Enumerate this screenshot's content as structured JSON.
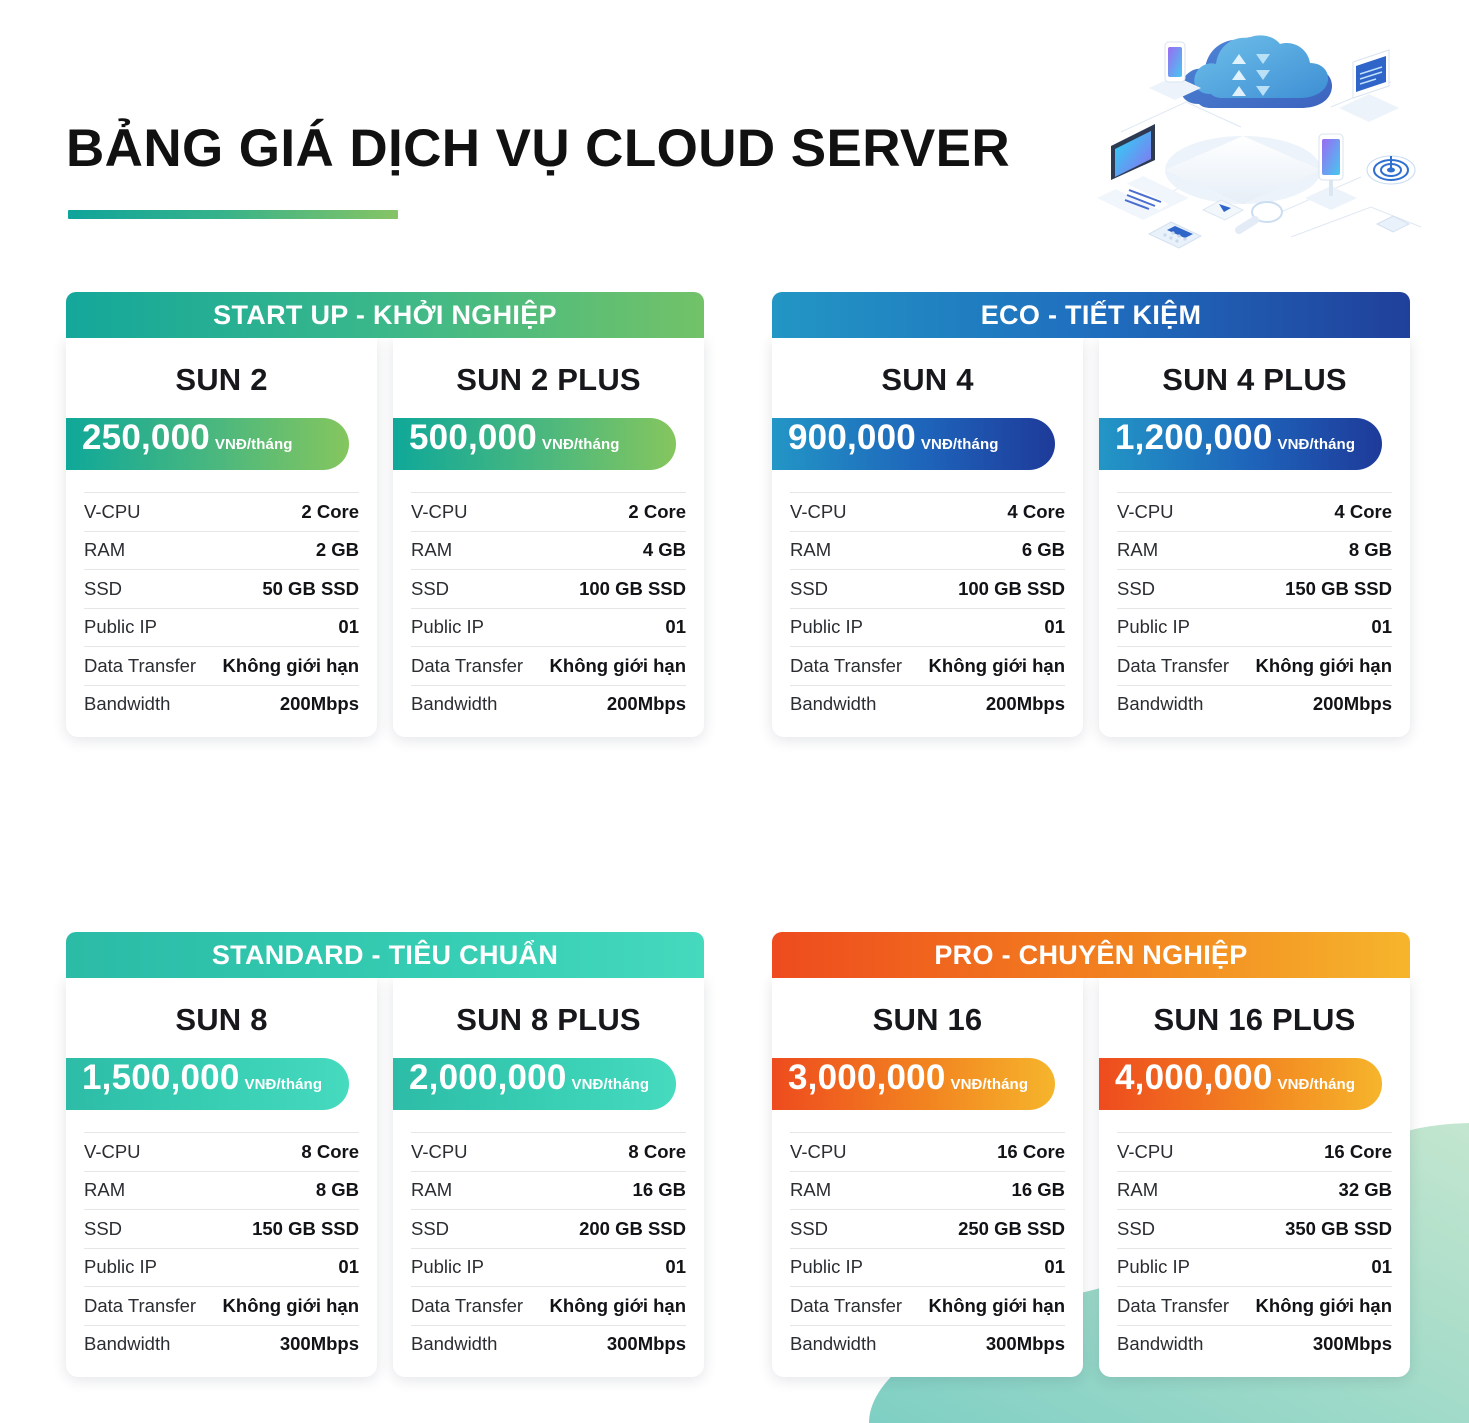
{
  "header": {
    "title": "BẢNG GIÁ DỊCH VỤ CLOUD SERVER",
    "illustration_name": "isometric-cloud-computing-illustration"
  },
  "colors": {
    "startup_from": "#14A79B",
    "startup_to": "#72C268",
    "eco_from": "#2296C4",
    "eco_to": "#20409B",
    "standard_from": "#2BBBA6",
    "standard_to": "#45D9BE",
    "pro_from": "#EE4B1E",
    "pro_to": "#F6B52C",
    "corner_wave": "#A8DCCB"
  },
  "spec_labels": [
    "V-CPU",
    "RAM",
    "SSD",
    "Public IP",
    "Data Transfer",
    "Bandwidth"
  ],
  "groups": [
    {
      "id": "startup",
      "title": "START UP - KHỞI NGHIỆP",
      "plans": [
        {
          "name": "SUN 2",
          "price": "250,000",
          "unit": "VNĐ/tháng",
          "specs": {
            "vcpu": "2 Core",
            "ram": "2 GB",
            "ssd": "50 GB SSD",
            "public_ip": "01",
            "data_transfer": "Không giới hạn",
            "bandwidth": "200Mbps"
          }
        },
        {
          "name": "SUN 2 PLUS",
          "price": "500,000",
          "unit": "VNĐ/tháng",
          "specs": {
            "vcpu": "2 Core",
            "ram": "4 GB",
            "ssd": "100 GB SSD",
            "public_ip": "01",
            "data_transfer": "Không giới hạn",
            "bandwidth": "200Mbps"
          }
        }
      ]
    },
    {
      "id": "eco",
      "title": "ECO - TIẾT KIỆM",
      "plans": [
        {
          "name": "SUN 4",
          "price": "900,000",
          "unit": "VNĐ/tháng",
          "specs": {
            "vcpu": "4 Core",
            "ram": "6 GB",
            "ssd": "100 GB SSD",
            "public_ip": "01",
            "data_transfer": "Không giới hạn",
            "bandwidth": "200Mbps"
          }
        },
        {
          "name": "SUN 4 PLUS",
          "price": "1,200,000",
          "unit": "VNĐ/tháng",
          "specs": {
            "vcpu": "4 Core",
            "ram": "8 GB",
            "ssd": "150 GB SSD",
            "public_ip": "01",
            "data_transfer": "Không giới hạn",
            "bandwidth": "200Mbps"
          }
        }
      ]
    },
    {
      "id": "standard",
      "title": "STANDARD - TIÊU CHUẨN",
      "plans": [
        {
          "name": "SUN 8",
          "price": "1,500,000",
          "unit": "VNĐ/tháng",
          "specs": {
            "vcpu": "8 Core",
            "ram": "8 GB",
            "ssd": "150 GB SSD",
            "public_ip": "01",
            "data_transfer": "Không giới hạn",
            "bandwidth": "300Mbps"
          }
        },
        {
          "name": "SUN 8 PLUS",
          "price": "2,000,000",
          "unit": "VNĐ/tháng",
          "specs": {
            "vcpu": "8 Core",
            "ram": "16 GB",
            "ssd": "200 GB SSD",
            "public_ip": "01",
            "data_transfer": "Không giới hạn",
            "bandwidth": "300Mbps"
          }
        }
      ]
    },
    {
      "id": "pro",
      "title": "PRO - CHUYÊN NGHIỆP",
      "plans": [
        {
          "name": "SUN 16",
          "price": "3,000,000",
          "unit": "VNĐ/tháng",
          "specs": {
            "vcpu": "16 Core",
            "ram": "16 GB",
            "ssd": "250 GB SSD",
            "public_ip": "01",
            "data_transfer": "Không giới hạn",
            "bandwidth": "300Mbps"
          }
        },
        {
          "name": "SUN 16 PLUS",
          "price": "4,000,000",
          "unit": "VNĐ/tháng",
          "specs": {
            "vcpu": "16 Core",
            "ram": "32 GB",
            "ssd": "350 GB SSD",
            "public_ip": "01",
            "data_transfer": "Không giới hạn",
            "bandwidth": "300Mbps"
          }
        }
      ]
    }
  ]
}
